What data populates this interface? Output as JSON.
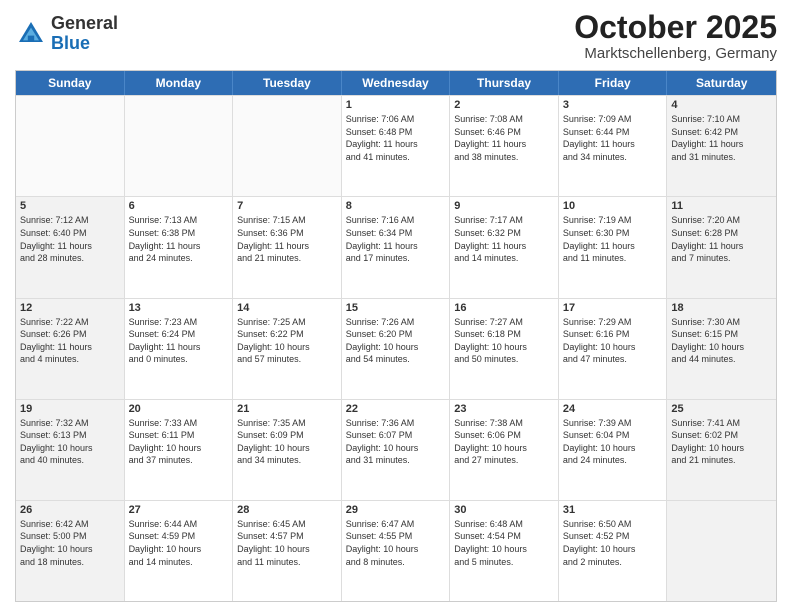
{
  "header": {
    "logo_general": "General",
    "logo_blue": "Blue",
    "month": "October 2025",
    "location": "Marktschellenberg, Germany"
  },
  "weekdays": [
    "Sunday",
    "Monday",
    "Tuesday",
    "Wednesday",
    "Thursday",
    "Friday",
    "Saturday"
  ],
  "rows": [
    [
      {
        "day": "",
        "info": "",
        "empty": true
      },
      {
        "day": "",
        "info": "",
        "empty": true
      },
      {
        "day": "",
        "info": "",
        "empty": true
      },
      {
        "day": "1",
        "info": "Sunrise: 7:06 AM\nSunset: 6:48 PM\nDaylight: 11 hours\nand 41 minutes."
      },
      {
        "day": "2",
        "info": "Sunrise: 7:08 AM\nSunset: 6:46 PM\nDaylight: 11 hours\nand 38 minutes."
      },
      {
        "day": "3",
        "info": "Sunrise: 7:09 AM\nSunset: 6:44 PM\nDaylight: 11 hours\nand 34 minutes."
      },
      {
        "day": "4",
        "info": "Sunrise: 7:10 AM\nSunset: 6:42 PM\nDaylight: 11 hours\nand 31 minutes.",
        "shaded": true
      }
    ],
    [
      {
        "day": "5",
        "info": "Sunrise: 7:12 AM\nSunset: 6:40 PM\nDaylight: 11 hours\nand 28 minutes.",
        "shaded": true
      },
      {
        "day": "6",
        "info": "Sunrise: 7:13 AM\nSunset: 6:38 PM\nDaylight: 11 hours\nand 24 minutes."
      },
      {
        "day": "7",
        "info": "Sunrise: 7:15 AM\nSunset: 6:36 PM\nDaylight: 11 hours\nand 21 minutes."
      },
      {
        "day": "8",
        "info": "Sunrise: 7:16 AM\nSunset: 6:34 PM\nDaylight: 11 hours\nand 17 minutes."
      },
      {
        "day": "9",
        "info": "Sunrise: 7:17 AM\nSunset: 6:32 PM\nDaylight: 11 hours\nand 14 minutes."
      },
      {
        "day": "10",
        "info": "Sunrise: 7:19 AM\nSunset: 6:30 PM\nDaylight: 11 hours\nand 11 minutes."
      },
      {
        "day": "11",
        "info": "Sunrise: 7:20 AM\nSunset: 6:28 PM\nDaylight: 11 hours\nand 7 minutes.",
        "shaded": true
      }
    ],
    [
      {
        "day": "12",
        "info": "Sunrise: 7:22 AM\nSunset: 6:26 PM\nDaylight: 11 hours\nand 4 minutes.",
        "shaded": true
      },
      {
        "day": "13",
        "info": "Sunrise: 7:23 AM\nSunset: 6:24 PM\nDaylight: 11 hours\nand 0 minutes."
      },
      {
        "day": "14",
        "info": "Sunrise: 7:25 AM\nSunset: 6:22 PM\nDaylight: 10 hours\nand 57 minutes."
      },
      {
        "day": "15",
        "info": "Sunrise: 7:26 AM\nSunset: 6:20 PM\nDaylight: 10 hours\nand 54 minutes."
      },
      {
        "day": "16",
        "info": "Sunrise: 7:27 AM\nSunset: 6:18 PM\nDaylight: 10 hours\nand 50 minutes."
      },
      {
        "day": "17",
        "info": "Sunrise: 7:29 AM\nSunset: 6:16 PM\nDaylight: 10 hours\nand 47 minutes."
      },
      {
        "day": "18",
        "info": "Sunrise: 7:30 AM\nSunset: 6:15 PM\nDaylight: 10 hours\nand 44 minutes.",
        "shaded": true
      }
    ],
    [
      {
        "day": "19",
        "info": "Sunrise: 7:32 AM\nSunset: 6:13 PM\nDaylight: 10 hours\nand 40 minutes.",
        "shaded": true
      },
      {
        "day": "20",
        "info": "Sunrise: 7:33 AM\nSunset: 6:11 PM\nDaylight: 10 hours\nand 37 minutes."
      },
      {
        "day": "21",
        "info": "Sunrise: 7:35 AM\nSunset: 6:09 PM\nDaylight: 10 hours\nand 34 minutes."
      },
      {
        "day": "22",
        "info": "Sunrise: 7:36 AM\nSunset: 6:07 PM\nDaylight: 10 hours\nand 31 minutes."
      },
      {
        "day": "23",
        "info": "Sunrise: 7:38 AM\nSunset: 6:06 PM\nDaylight: 10 hours\nand 27 minutes."
      },
      {
        "day": "24",
        "info": "Sunrise: 7:39 AM\nSunset: 6:04 PM\nDaylight: 10 hours\nand 24 minutes."
      },
      {
        "day": "25",
        "info": "Sunrise: 7:41 AM\nSunset: 6:02 PM\nDaylight: 10 hours\nand 21 minutes.",
        "shaded": true
      }
    ],
    [
      {
        "day": "26",
        "info": "Sunrise: 6:42 AM\nSunset: 5:00 PM\nDaylight: 10 hours\nand 18 minutes.",
        "shaded": true
      },
      {
        "day": "27",
        "info": "Sunrise: 6:44 AM\nSunset: 4:59 PM\nDaylight: 10 hours\nand 14 minutes."
      },
      {
        "day": "28",
        "info": "Sunrise: 6:45 AM\nSunset: 4:57 PM\nDaylight: 10 hours\nand 11 minutes."
      },
      {
        "day": "29",
        "info": "Sunrise: 6:47 AM\nSunset: 4:55 PM\nDaylight: 10 hours\nand 8 minutes."
      },
      {
        "day": "30",
        "info": "Sunrise: 6:48 AM\nSunset: 4:54 PM\nDaylight: 10 hours\nand 5 minutes."
      },
      {
        "day": "31",
        "info": "Sunrise: 6:50 AM\nSunset: 4:52 PM\nDaylight: 10 hours\nand 2 minutes."
      },
      {
        "day": "",
        "info": "",
        "empty": true,
        "shaded": true
      }
    ]
  ]
}
